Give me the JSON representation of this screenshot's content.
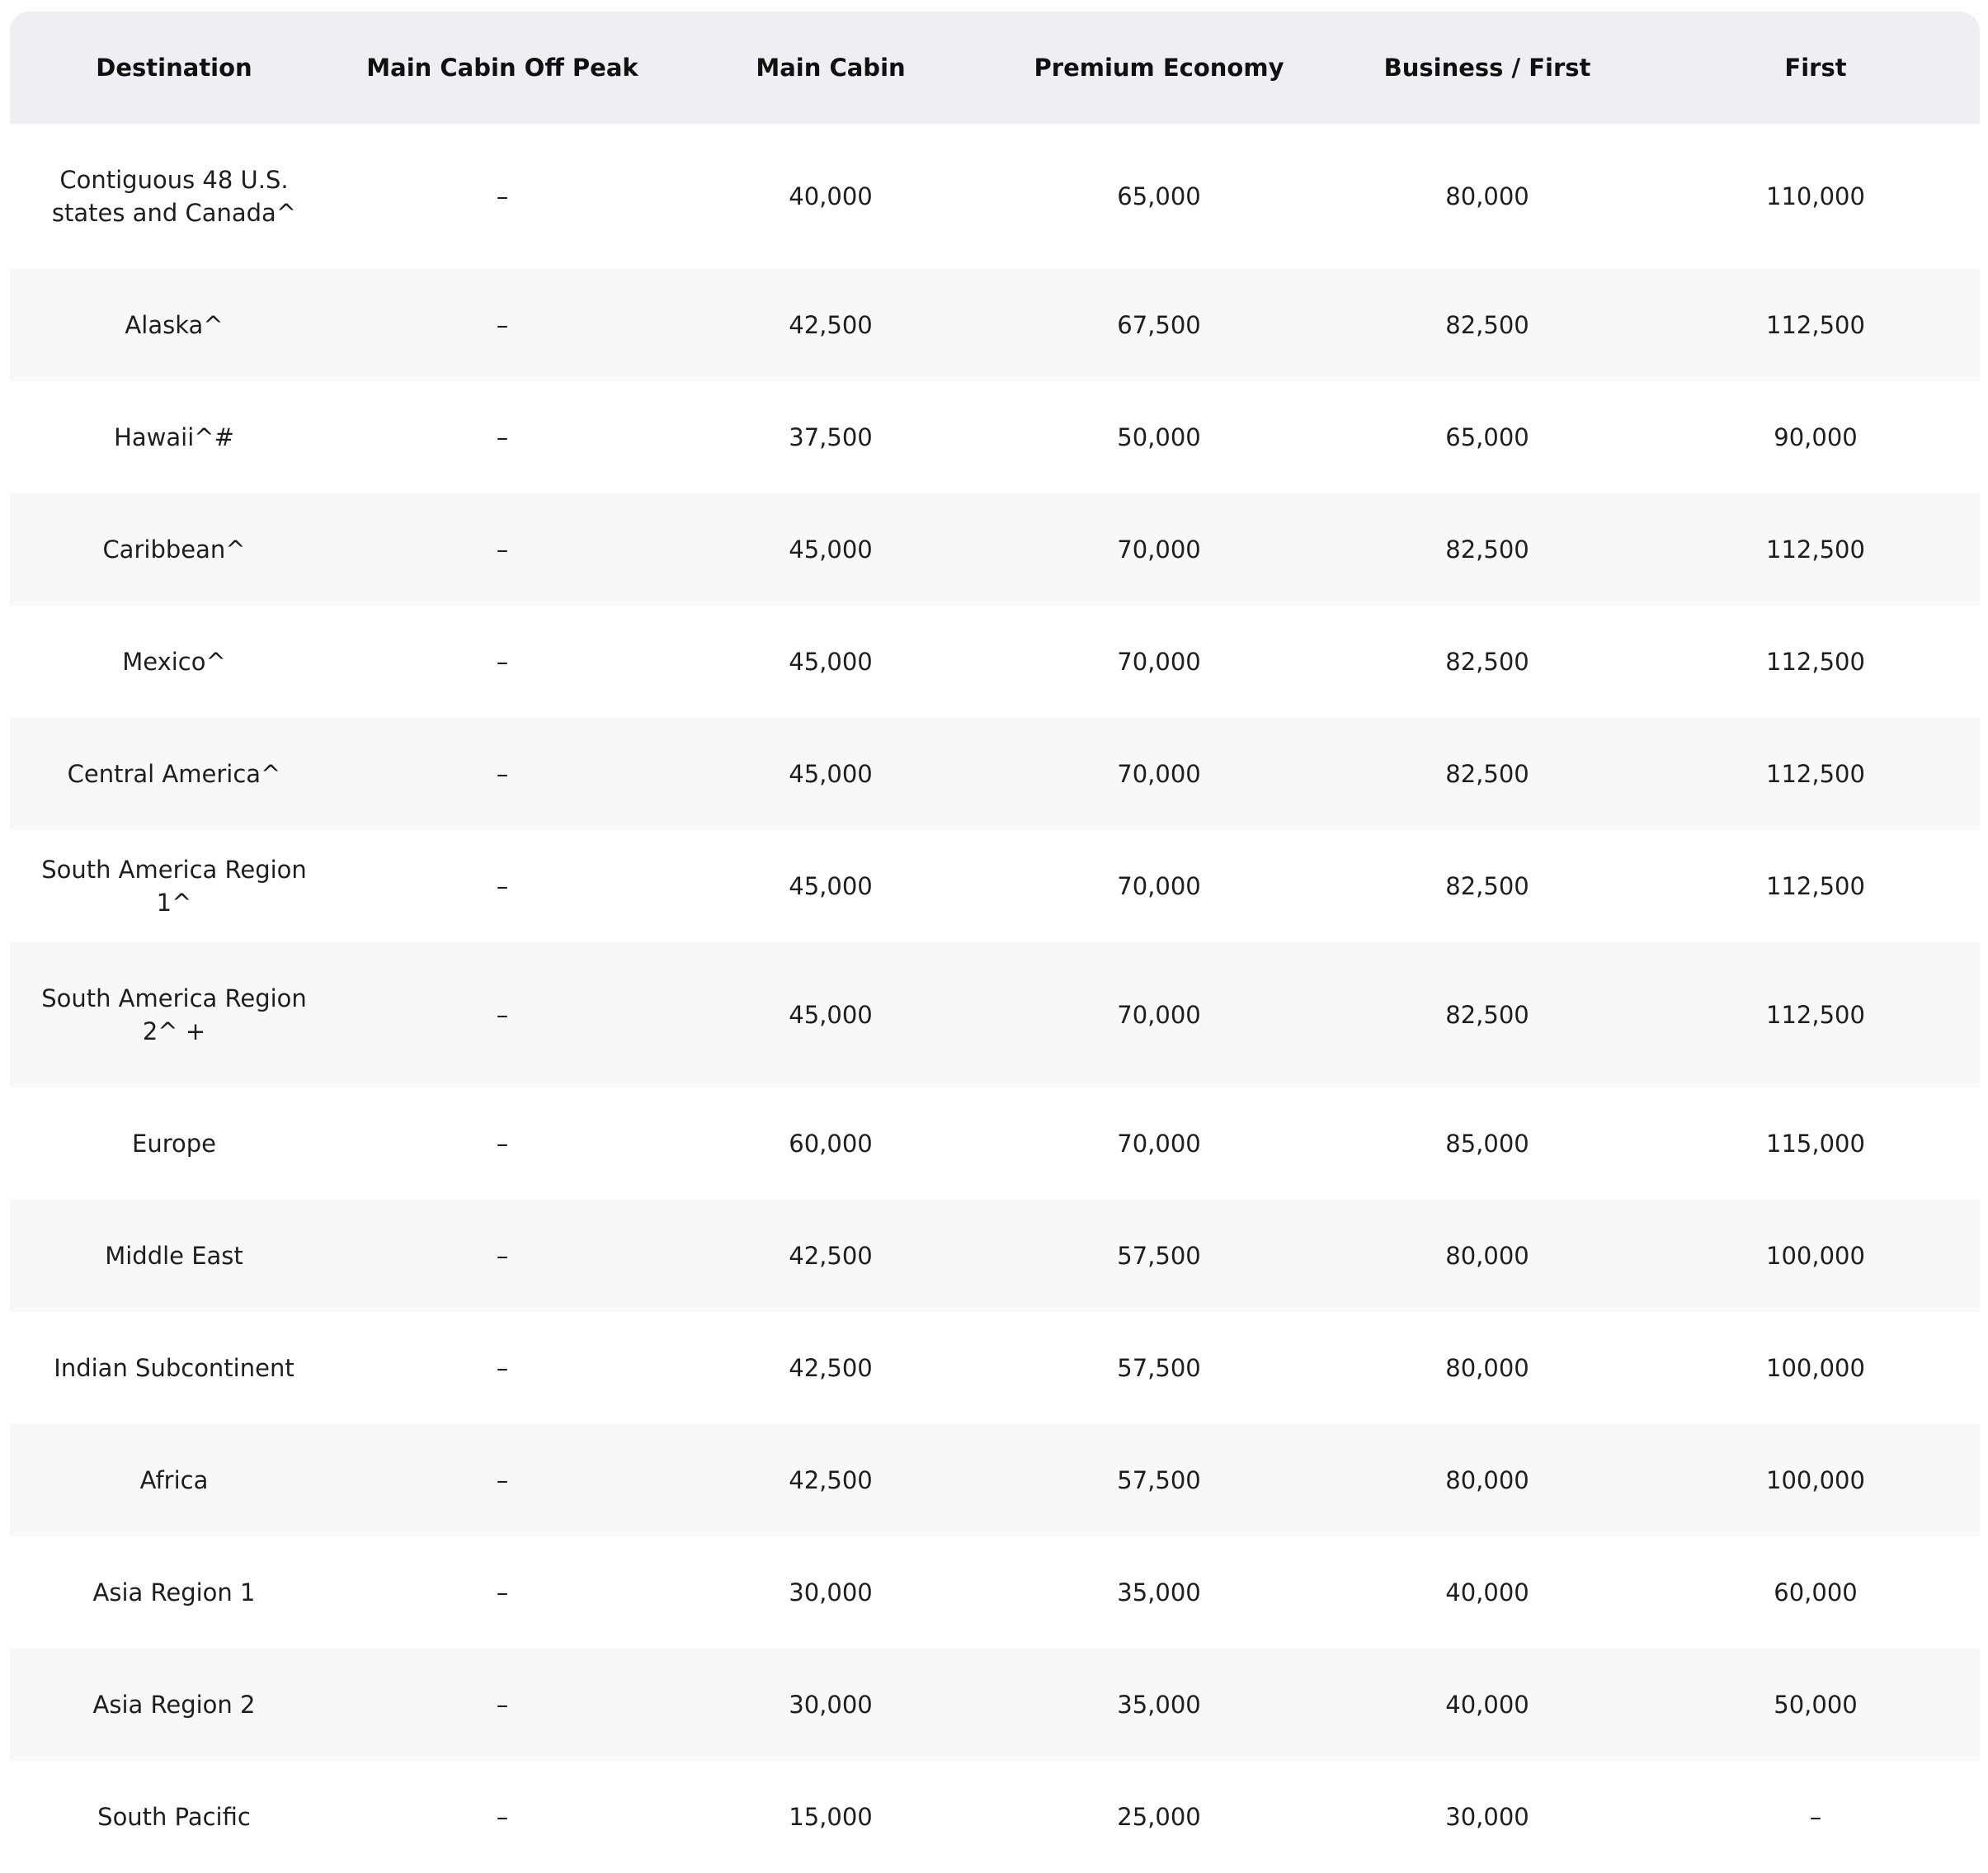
{
  "colors": {
    "header_bg": "#eeeff2",
    "row_alt_bg": "#f7f8fa",
    "row_bg": "#ffffff",
    "text": "#1e1e1e"
  },
  "table": {
    "headers": [
      "Destination",
      "Main Cabin Off Peak",
      "Main Cabin",
      "Premium Economy",
      "Business / First",
      "First"
    ],
    "rows": [
      [
        "Contiguous 48 U.S. states and Canada^",
        "–",
        "40,000",
        "65,000",
        "80,000",
        "110,000"
      ],
      [
        "Alaska^",
        "–",
        "42,500",
        "67,500",
        "82,500",
        "112,500"
      ],
      [
        "Hawaii^#",
        "–",
        "37,500",
        "50,000",
        "65,000",
        "90,000"
      ],
      [
        "Caribbean^",
        "–",
        "45,000",
        "70,000",
        "82,500",
        "112,500"
      ],
      [
        "Mexico^",
        "–",
        "45,000",
        "70,000",
        "82,500",
        "112,500"
      ],
      [
        "Central America^",
        "–",
        "45,000",
        "70,000",
        "82,500",
        "112,500"
      ],
      [
        "South America Region 1^",
        "–",
        "45,000",
        "70,000",
        "82,500",
        "112,500"
      ],
      [
        "South America Region 2^ +",
        "–",
        "45,000",
        "70,000",
        "82,500",
        "112,500"
      ],
      [
        "Europe",
        "–",
        "60,000",
        "70,000",
        "85,000",
        "115,000"
      ],
      [
        "Middle East",
        "–",
        "42,500",
        "57,500",
        "80,000",
        "100,000"
      ],
      [
        "Indian Subcontinent",
        "–",
        "42,500",
        "57,500",
        "80,000",
        "100,000"
      ],
      [
        "Africa",
        "–",
        "42,500",
        "57,500",
        "80,000",
        "100,000"
      ],
      [
        "Asia Region 1",
        "–",
        "30,000",
        "35,000",
        "40,000",
        "60,000"
      ],
      [
        "Asia Region 2",
        "–",
        "30,000",
        "35,000",
        "40,000",
        "50,000"
      ],
      [
        "South Pacific",
        "–",
        "15,000",
        "25,000",
        "30,000",
        "–"
      ]
    ]
  }
}
